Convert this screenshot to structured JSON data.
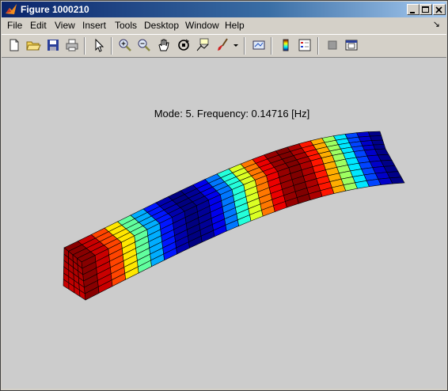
{
  "window": {
    "title": "Figure 1000210"
  },
  "menu": [
    "File",
    "Edit",
    "View",
    "Insert",
    "Tools",
    "Desktop",
    "Window",
    "Help"
  ],
  "toolbar_icons": [
    "new-figure-icon",
    "open-file-icon",
    "save-icon",
    "print-icon",
    "select-arrow-icon",
    "zoom-in-icon",
    "zoom-out-icon",
    "pan-hand-icon",
    "rotate-3d-icon",
    "data-cursor-icon",
    "brush-icon",
    "link-plot-icon",
    "colorbar-icon",
    "legend-icon",
    "hide-plot-tools-icon",
    "show-plot-tools-icon"
  ],
  "plot": {
    "title": "Mode: 5. Frequency: 0.14716 [Hz]"
  }
}
